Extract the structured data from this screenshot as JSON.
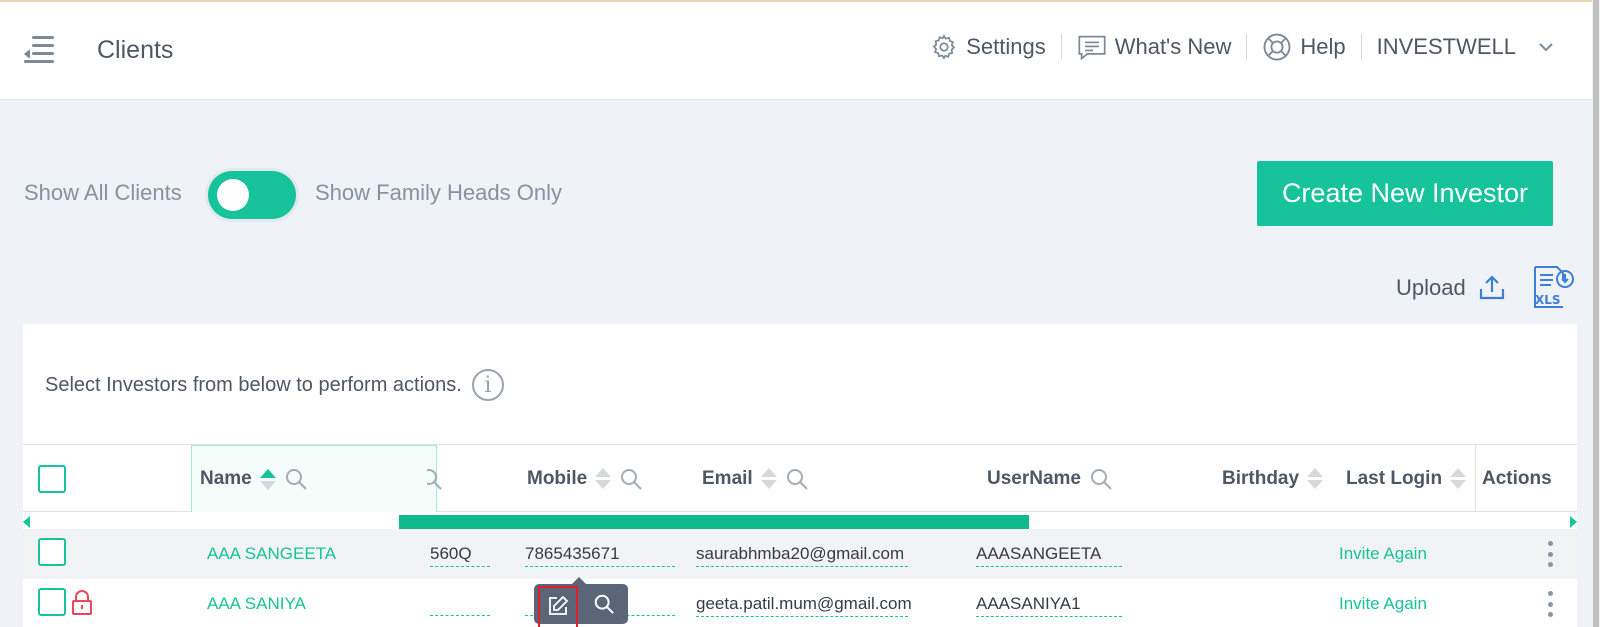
{
  "header": {
    "page_title": "Clients",
    "nav": [
      {
        "label": "Settings",
        "icon": "gear-icon"
      },
      {
        "label": "What's New",
        "icon": "message-icon"
      },
      {
        "label": "Help",
        "icon": "lifebuoy-icon"
      },
      {
        "label": "INVESTWELL",
        "icon": "chevron-down-icon"
      }
    ]
  },
  "controls": {
    "show_all_label": "Show All Clients",
    "show_heads_label": "Show Family Heads Only",
    "create_button": "Create New Investor",
    "upload_label": "Upload",
    "xls_label": "XLS"
  },
  "panel": {
    "helper_text": "Select Investors from below to perform actions.",
    "info_glyph": "i"
  },
  "table": {
    "columns": {
      "name": "Name",
      "mobile": "Mobile",
      "email": "Email",
      "username": "UserName",
      "birthday": "Birthday",
      "last_login": "Last Login",
      "actions": "Actions"
    },
    "rows": [
      {
        "name": "AAA SANGEETA",
        "pan": "560Q",
        "mobile": "7865435671",
        "email": "saurabhmba20@gmail.com",
        "username": "AAASANGEETA",
        "last_login": "Invite Again",
        "locked": false
      },
      {
        "name": "AAA SANIYA",
        "pan": "",
        "mobile": "",
        "email": "geeta.patil.mum@gmail.com",
        "username": "AAASANIYA1",
        "last_login": "Invite Again",
        "locked": true
      }
    ]
  },
  "colors": {
    "accent": "#16c39a",
    "highlight": "#e11d2a",
    "popover": "#5a6577"
  }
}
